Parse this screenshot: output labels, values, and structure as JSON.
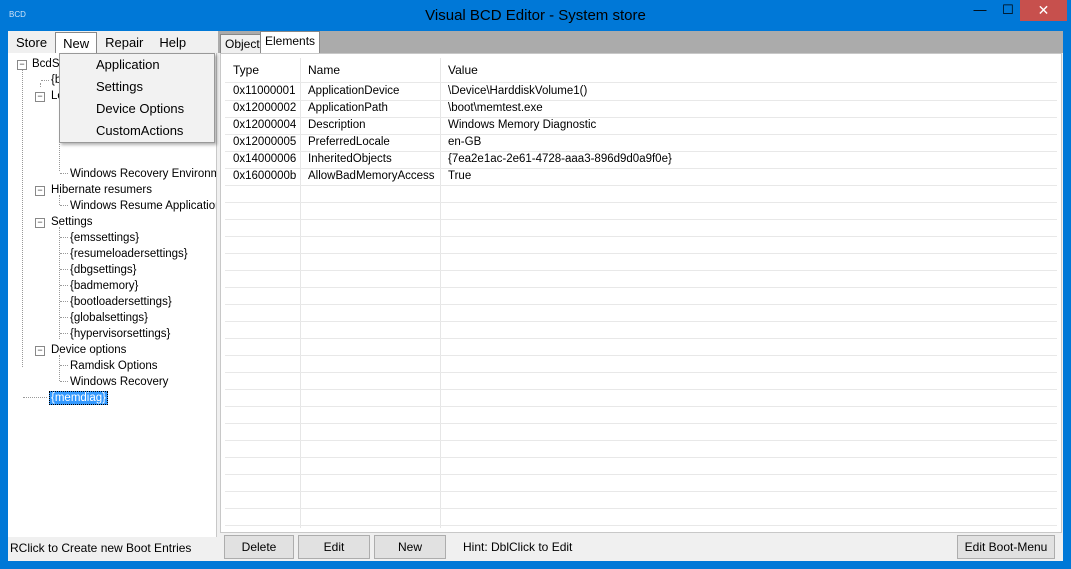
{
  "window": {
    "title": "Visual BCD Editor - System store",
    "app_icon_label": "BCD",
    "min_glyph": "—",
    "max_glyph": "☐",
    "close_glyph": "✕"
  },
  "menu": {
    "items": [
      "Store",
      "New",
      "Repair",
      "Help"
    ],
    "new_dropdown": [
      "Application",
      "Settings",
      "Device Options",
      "CustomActions"
    ]
  },
  "tree": {
    "root": "BcdSt",
    "root_child": "{b",
    "loaders_partial": "Lo",
    "recovery_partial": "Windows Recovery Environme",
    "hibernate": "Hibernate resumers",
    "hibernate_child": "Windows Resume Application",
    "settings": "Settings",
    "settings_children": [
      "{emssettings}",
      "{resumeloadersettings}",
      "{dbgsettings}",
      "{badmemory}",
      "{bootloadersettings}",
      "{globalsettings}",
      "{hypervisorsettings}"
    ],
    "device_options": "Device options",
    "device_children": [
      "Ramdisk Options",
      "Windows Recovery"
    ],
    "memdiag": "{memdiag}"
  },
  "left_status": "RClick to Create new Boot Entries",
  "tabs": [
    "Object",
    "Elements"
  ],
  "grid": {
    "headers": [
      "Type",
      "Name",
      "Value"
    ],
    "rows": [
      [
        "0x11000001",
        "ApplicationDevice",
        "\\Device\\HarddiskVolume1()"
      ],
      [
        "0x12000002",
        "ApplicationPath",
        "\\boot\\memtest.exe"
      ],
      [
        "0x12000004",
        "Description",
        "Windows Memory Diagnostic"
      ],
      [
        "0x12000005",
        "PreferredLocale",
        "en-GB"
      ],
      [
        "0x14000006",
        "InheritedObjects",
        "{7ea2e1ac-2e61-4728-aaa3-896d9d0a9f0e}"
      ],
      [
        "0x1600000b",
        "AllowBadMemoryAccess",
        "True"
      ]
    ]
  },
  "buttons": {
    "delete": "Delete",
    "edit": "Edit",
    "new": "New",
    "hint": "Hint: DblClick to Edit",
    "edit_boot_menu": "Edit Boot-Menu"
  }
}
